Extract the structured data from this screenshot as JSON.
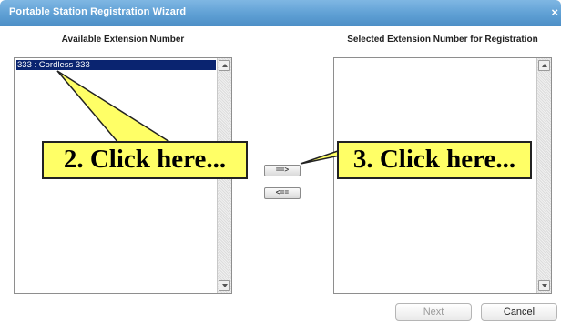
{
  "window": {
    "title": "Portable Station Registration Wizard",
    "close_glyph": "×"
  },
  "available": {
    "heading": "Available Extension Number",
    "items": [
      "333 : Cordless 333"
    ],
    "selected_index": 0
  },
  "selected": {
    "heading": "Selected Extension Number for Registration",
    "items": []
  },
  "transfer": {
    "add_label": "==>",
    "remove_label": "<=="
  },
  "footer": {
    "next_label": "Next",
    "cancel_label": "Cancel",
    "next_enabled": false
  },
  "annotations": {
    "callout_2": "2. Click here...",
    "callout_3": "3. Click here...",
    "fill_color": "#ffff66"
  },
  "colors": {
    "titlebar": "#5e9fd4",
    "selection": "#0a2470"
  }
}
